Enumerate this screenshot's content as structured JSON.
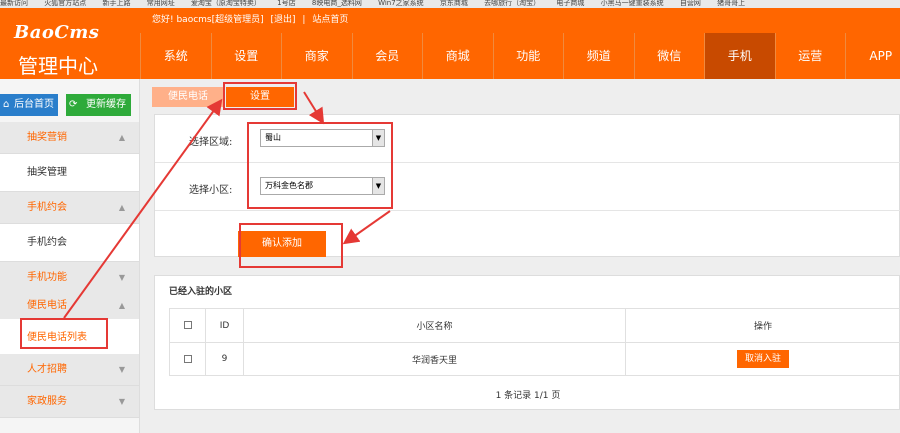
{
  "bookmarks": [
    "最新访问",
    "火狐官方站点",
    "新手上路",
    "常用网址",
    "爱淘宝（原淘宝特卖）",
    "1号店",
    "8映电商_选料网",
    "Win7之家系统",
    "京东商城",
    "去哪旅行（淘宝）",
    "电子商城",
    "小黑马一键重装系统",
    "自营网",
    "猪哥哥上"
  ],
  "header": {
    "logo": "BaoCms",
    "admin_title": "管理中心",
    "greeting": "您好! baocms[超级管理员]",
    "logout": "[退出]",
    "separator": "|",
    "site_home": "站点首页"
  },
  "nav": [
    {
      "label": "系统",
      "active": false
    },
    {
      "label": "设置",
      "active": false
    },
    {
      "label": "商家",
      "active": false
    },
    {
      "label": "会员",
      "active": false
    },
    {
      "label": "商城",
      "active": false
    },
    {
      "label": "功能",
      "active": false
    },
    {
      "label": "频道",
      "active": false
    },
    {
      "label": "微信",
      "active": false
    },
    {
      "label": "手机",
      "active": true
    },
    {
      "label": "运营",
      "active": false
    },
    {
      "label": "APP",
      "active": false
    }
  ],
  "sidebar": {
    "home_button": "后台首页",
    "cache_button": "更新缓存",
    "groups": [
      {
        "label": "抽奖营销",
        "item": "抽奖管理"
      },
      {
        "label": "手机约会",
        "item": "手机约会"
      },
      {
        "label": "手机功能"
      },
      {
        "label": "便民电话",
        "item": "便民电话列表"
      },
      {
        "label": "人才招聘"
      },
      {
        "label": "家政服务"
      }
    ]
  },
  "breadcrumb": {
    "parent": "便民电话",
    "current": "设置"
  },
  "form": {
    "area_label": "选择区域:",
    "area_value": "蜀山",
    "community_label": "选择小区:",
    "community_value": "万科金色名郡",
    "confirm_button": "确认添加"
  },
  "list": {
    "title": "已经入驻的小区",
    "columns": [
      "ID",
      "小区名称",
      "操作"
    ],
    "rows": [
      {
        "id": "9",
        "name": "华润香天里",
        "action": "取消入驻"
      }
    ],
    "pager": "1 条记录 1/1 页"
  },
  "colors": {
    "primary": "#ff6600",
    "nav_active": "#c84a00",
    "annotation": "#e53935"
  }
}
